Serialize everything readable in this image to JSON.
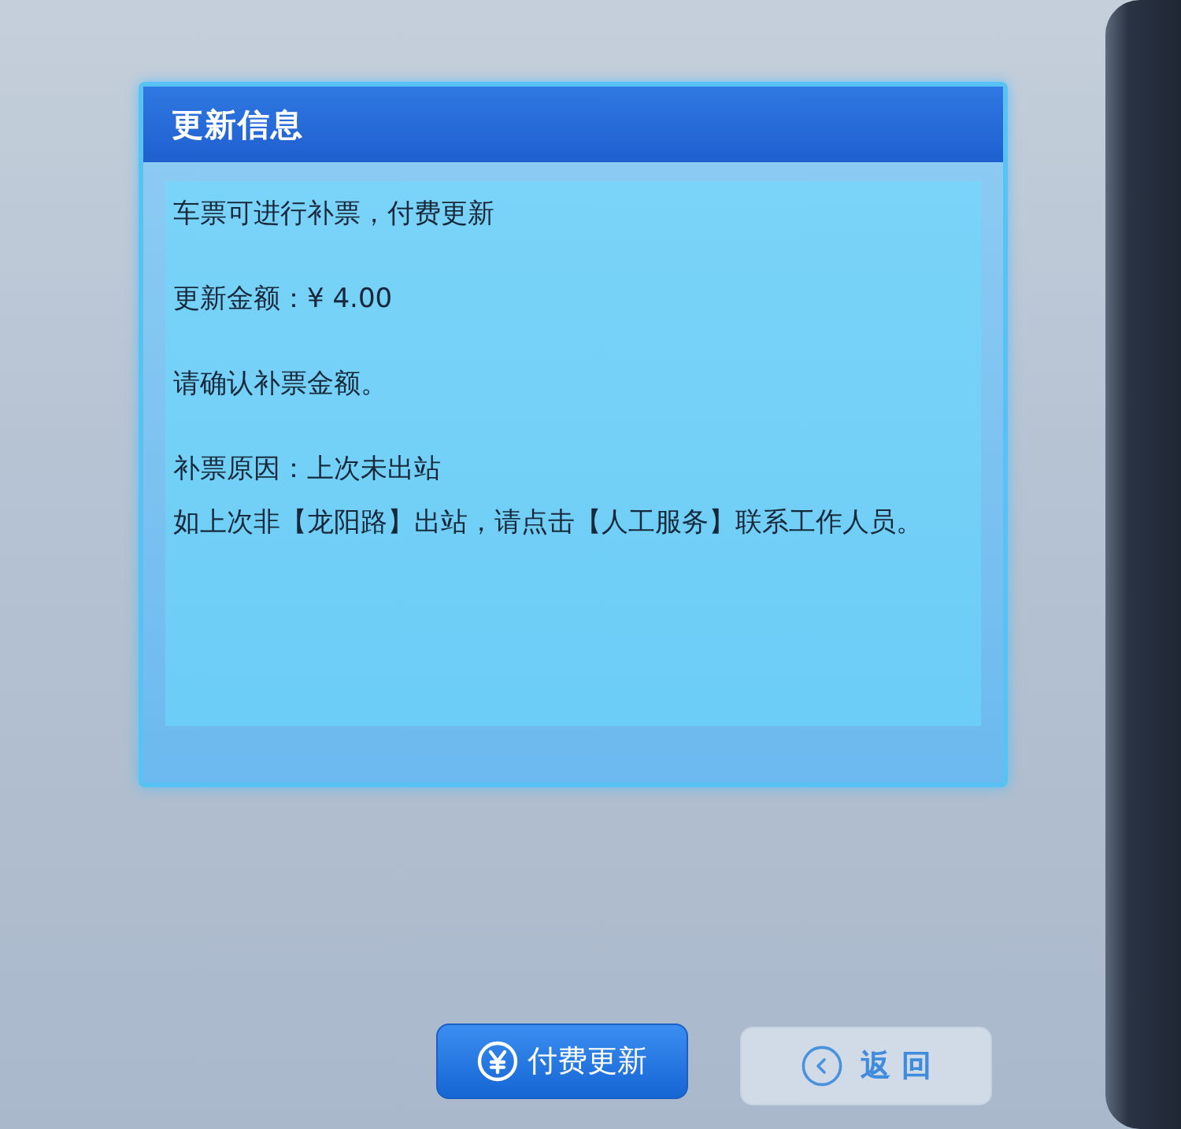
{
  "dialog": {
    "title": "更新信息",
    "paragraphs": [
      {
        "lines": [
          "车票可进行补票，付费更新"
        ]
      },
      {
        "lines": [
          "更新金额：¥ 4.00"
        ]
      },
      {
        "lines": [
          "请确认补票金额。"
        ]
      },
      {
        "lines": [
          "补票原因：上次未出站",
          "如上次非【龙阳路】出站，请点击【人工服务】联系工作人员。"
        ]
      }
    ]
  },
  "buttons": [
    {
      "kind": "primary",
      "label": "付费更新"
    },
    {
      "kind": "secondary",
      "label": "返 回"
    }
  ]
}
